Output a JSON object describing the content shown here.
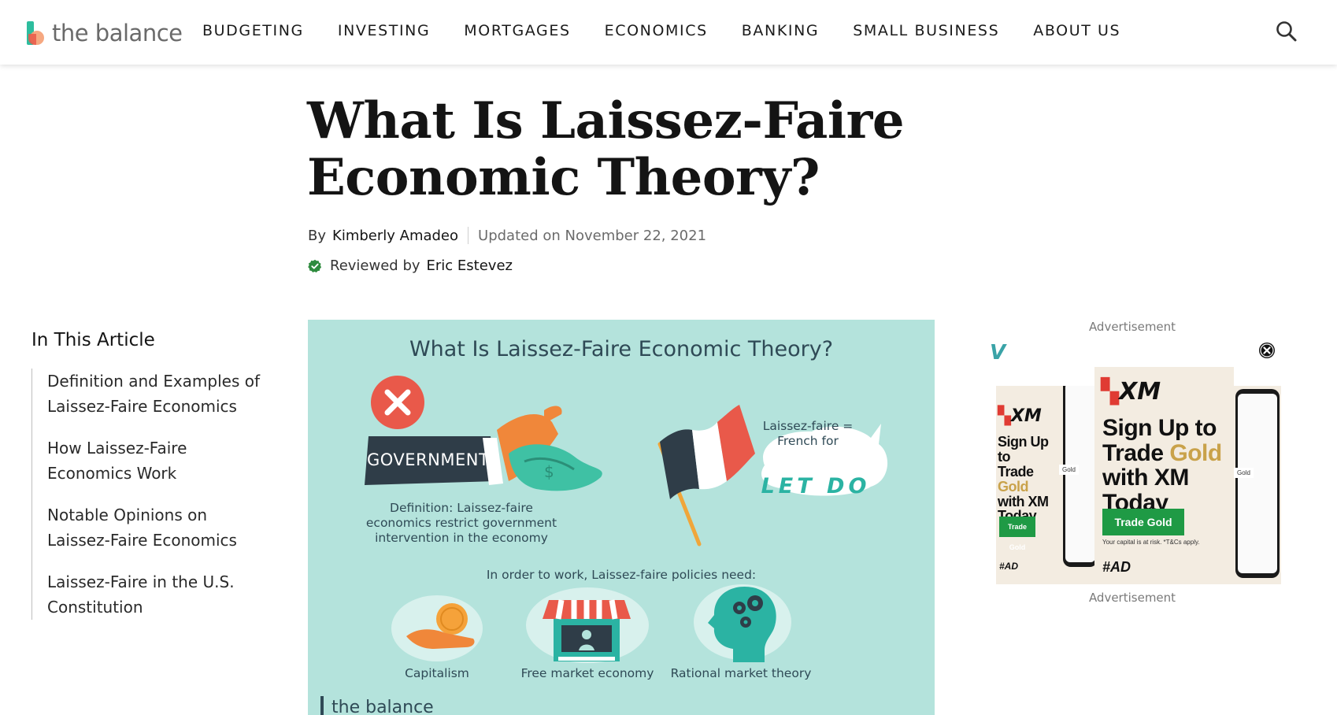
{
  "header": {
    "logo_text": "the balance",
    "nav": [
      "BUDGETING",
      "INVESTING",
      "MORTGAGES",
      "ECONOMICS",
      "BANKING",
      "SMALL BUSINESS",
      "ABOUT US"
    ]
  },
  "article": {
    "title": "What Is Laissez-Faire Economic Theory?",
    "by_label": "By",
    "author": "Kimberly Amadeo",
    "updated": "Updated on November 22, 2021",
    "reviewed_label": "Reviewed by",
    "reviewer": "Eric Estevez"
  },
  "toc": {
    "title": "In This Article",
    "items": [
      "Definition and Examples of Laissez-Faire Economics",
      "How Laissez-Faire Economics Work",
      "Notable Opinions on Laissez-Faire Economics",
      "Laissez-Faire in the U.S. Constitution"
    ]
  },
  "infographic": {
    "title": "What Is Laissez-Faire Economic Theory?",
    "government_label": "GOVERNMENT",
    "definition": "Definition: Laissez-faire economics restrict government intervention in the economy",
    "french_note": "Laissez-faire = French for",
    "let_do": "LET DO",
    "policies_intro": "In order to work, Laissez-faire policies need:",
    "needs": [
      "Capitalism",
      "Free market economy",
      "Rational market theory"
    ],
    "brand": "the balance",
    "colors": {
      "background": "#b4e3dc",
      "accent_red": "#e9594a",
      "accent_orange": "#f0873a",
      "text": "#2f4a56"
    }
  },
  "ad": {
    "label_top": "Advertisement",
    "label_bottom": "Advertisement",
    "brand": "XM",
    "headline_1": "Sign Up to",
    "headline_2": "Trade",
    "headline_gold": "Gold",
    "headline_3": "with XM Today",
    "cta": "Trade Gold",
    "risk": "Your capital is at risk. *T&Cs apply.",
    "tag": "#AD",
    "left_headline_1": "Sign Up to",
    "left_headline_2": "Trade",
    "left_headline_3": "with XM Today",
    "side_label": "Gold"
  }
}
